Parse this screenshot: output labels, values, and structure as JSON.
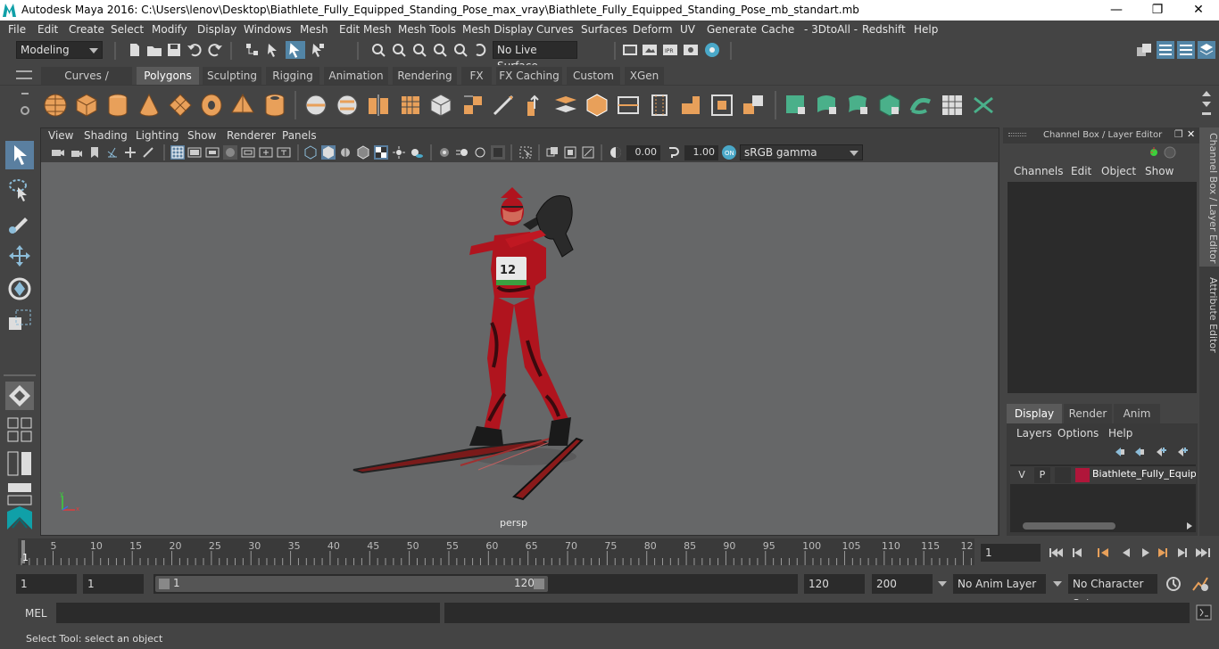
{
  "window": {
    "title": "Autodesk Maya 2016: C:\\Users\\lenov\\Desktop\\Biathlete_Fully_Equipped_Standing_Pose_max_vray\\Biathlete_Fully_Equipped_Standing_Pose_mb_standart.mb",
    "minimize": "—",
    "restore": "❐",
    "close": "✕"
  },
  "menubar": {
    "items": [
      "File",
      "Edit",
      "Create",
      "Select",
      "Modify",
      "Display",
      "Windows",
      "Mesh",
      "Edit Mesh",
      "Mesh Tools",
      "Mesh Display",
      "Curves",
      "Surfaces",
      "Deform",
      "UV",
      "Generate",
      "Cache",
      "- 3DtoAll -",
      "Redshift",
      "Help"
    ]
  },
  "statusline": {
    "mode": "Modeling",
    "live_surface": "No Live Surface"
  },
  "shelf": {
    "tabs": [
      "Curves / Surfaces",
      "Polygons",
      "Sculpting",
      "Rigging",
      "Animation",
      "Rendering",
      "FX",
      "FX Caching",
      "Custom",
      "XGen"
    ],
    "active_tab": "Polygons"
  },
  "viewport": {
    "menu": [
      "View",
      "Shading",
      "Lighting",
      "Show",
      "Renderer",
      "Panels"
    ],
    "exposure": "0.00",
    "gamma": "1.00",
    "color_space": "sRGB gamma",
    "camera_label": "persp",
    "figure_number": "12"
  },
  "channelbox": {
    "title": "Channel Box / Layer Editor",
    "menu": [
      "Channels",
      "Edit",
      "Object",
      "Show"
    ],
    "layer_tabs": [
      "Display",
      "Render",
      "Anim"
    ],
    "layer_menu": [
      "Layers",
      "Options",
      "Help"
    ],
    "layer": {
      "v": "V",
      "p": "P",
      "name": "Biathlete_Fully_Equipped",
      "color": "#b0163a"
    }
  },
  "sidetabs": {
    "channel_box": "Channel Box / Layer Editor",
    "attribute_editor": "Attribute Editor"
  },
  "timeline": {
    "ticks": [
      "5",
      "10",
      "15",
      "20",
      "25",
      "30",
      "35",
      "40",
      "45",
      "50",
      "55",
      "60",
      "65",
      "70",
      "75",
      "80",
      "85",
      "90",
      "95",
      "100",
      "105",
      "110",
      "115",
      "12"
    ],
    "current_marker": "1",
    "current_frame": "1"
  },
  "range": {
    "start": "1",
    "playback_start": "1",
    "slider_start": "1",
    "slider_end": "120",
    "playback_end": "120",
    "end": "200",
    "anim_layer": "No Anim Layer",
    "character_set": "No Character Set"
  },
  "cmdline": {
    "label": "MEL"
  },
  "helpline": {
    "text": "Select Tool: select an object"
  },
  "colors": {
    "accent": "#5285a6",
    "shelf_orange": "#e8a05a",
    "shelf_green": "#4ab08a",
    "viewport_bg": "#666768",
    "suit_red": "#b0141e"
  }
}
